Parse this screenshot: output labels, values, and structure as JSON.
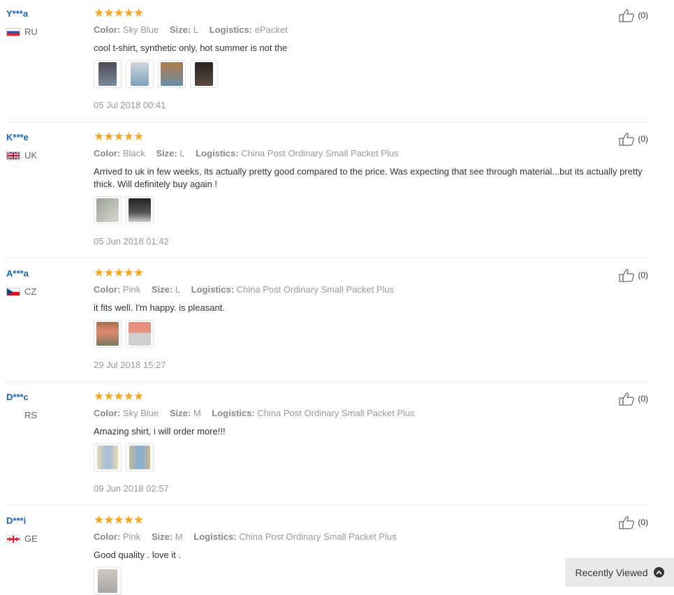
{
  "labels": {
    "color": "Color:",
    "size": "Size:",
    "logistics": "Logistics:"
  },
  "reviews": [
    {
      "user": "Y***a",
      "country": "RU",
      "rating": "★★★★★",
      "color": "Sky Blue",
      "size": "L",
      "logistics": "ePacket",
      "text": "cool t-shirt, synthetic only, hot summer is not the",
      "date": "05 Jul 2018 00:41",
      "likes": "(0)"
    },
    {
      "user": "K***e",
      "country": "UK",
      "rating": "★★★★★",
      "color": "Black",
      "size": "L",
      "logistics": "China Post Ordinary Small Packet Plus",
      "text": "Arrived to uk in few weeks, its actually pretty good compared to the price. Was expecting that see through material...but its actually pretty thick. Will definitely buy again !",
      "date": "05 Jun 2018 01:42",
      "likes": "(0)"
    },
    {
      "user": "A***a",
      "country": "CZ",
      "rating": "★★★★★",
      "color": "Pink",
      "size": "L",
      "logistics": "China Post Ordinary Small Packet Plus",
      "text": "it fits well. I'm happy. is pleasant.",
      "date": "29 Jul 2018 15:27",
      "likes": "(0)"
    },
    {
      "user": "D***c",
      "country": "RS",
      "rating": "★★★★★",
      "color": "Sky Blue",
      "size": "M",
      "logistics": "China Post Ordinary Small Packet Plus",
      "text": "Amazing shirt, i will order more!!!",
      "date": "09 Jun 2018 02:57",
      "likes": "(0)"
    },
    {
      "user": "D***i",
      "country": "GE",
      "rating": "★★★★★",
      "color": "Pink",
      "size": "M",
      "logistics": "China Post Ordinary Small Packet Plus",
      "text": "Good quality . love it .",
      "date": "",
      "likes": "(0)"
    }
  ],
  "colors": {
    "username": "#1a64b4",
    "star": "#f6a623",
    "meta": "#999999"
  },
  "recently_viewed": {
    "label": "Recently Viewed",
    "icon": "chevron-up-icon"
  }
}
